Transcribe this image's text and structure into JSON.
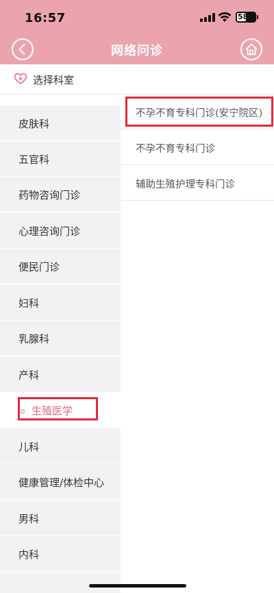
{
  "status_bar": {
    "time": "16:57",
    "battery": "58"
  },
  "header": {
    "title": "网络问诊"
  },
  "section": {
    "label": "选择科室"
  },
  "departments": [
    {
      "label": "皮肤科"
    },
    {
      "label": "五官科"
    },
    {
      "label": "药物咨询门诊"
    },
    {
      "label": "心理咨询门诊"
    },
    {
      "label": "便民门诊"
    },
    {
      "label": "妇科"
    },
    {
      "label": "乳腺科"
    },
    {
      "label": "产科"
    },
    {
      "label": "生殖医学",
      "active": true
    },
    {
      "label": "儿科"
    },
    {
      "label": "健康管理/体检中心"
    },
    {
      "label": "男科"
    },
    {
      "label": "内科"
    }
  ],
  "clinics": [
    {
      "label": "不孕不育专科门诊(安宁院区)"
    },
    {
      "label": "不孕不育专科门诊"
    },
    {
      "label": "辅助生殖护理专科门诊"
    }
  ],
  "colors": {
    "header_bg": "#eba4ad",
    "accent": "#e26b83",
    "highlight": "#e32a3a"
  }
}
